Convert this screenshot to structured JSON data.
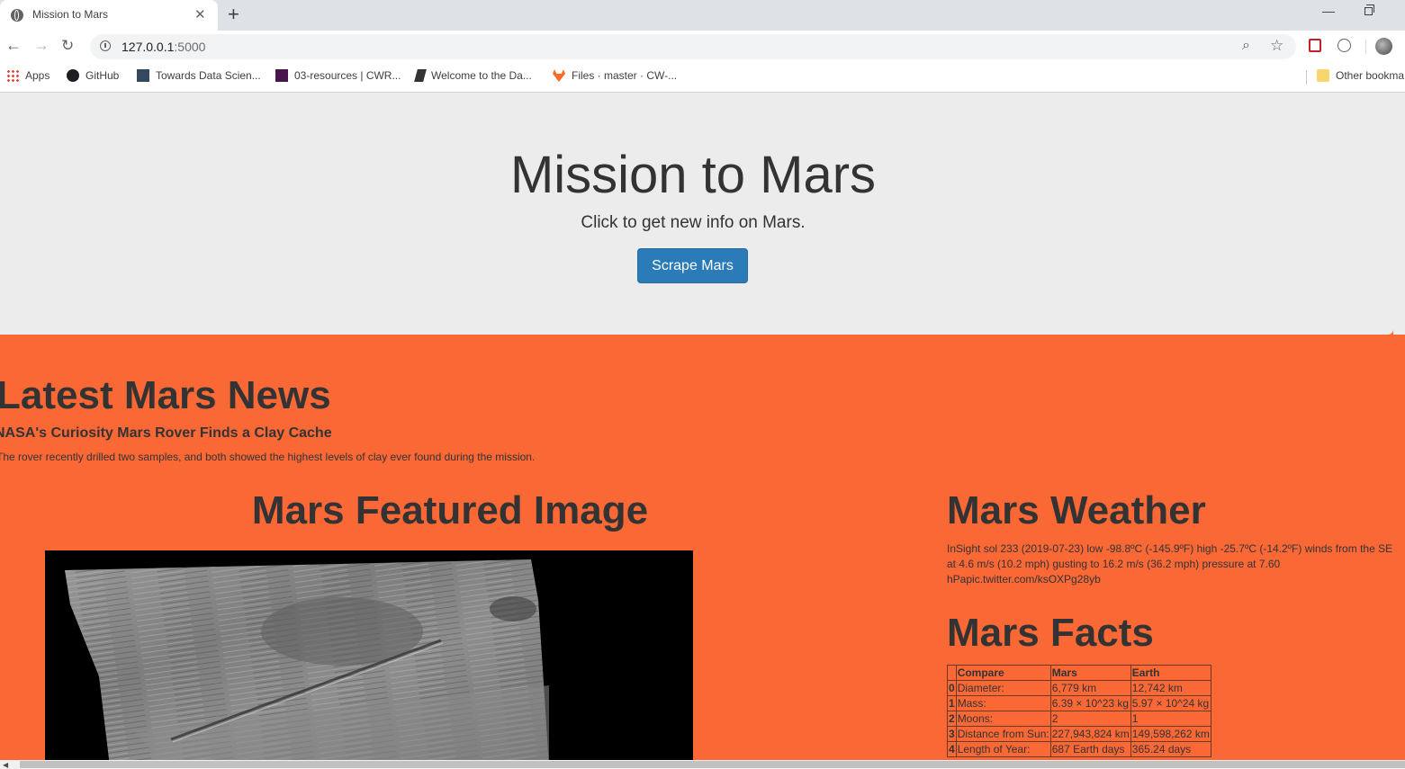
{
  "browser": {
    "tab_title": "Mission to Mars",
    "new_tab": "+",
    "url_host": "127.0.0.1",
    "url_port": ":5000",
    "bookmarks": {
      "apps": "Apps",
      "github": "GitHub",
      "tds": "Towards Data Scien...",
      "cwr": "03-resources | CWR...",
      "data": "Welcome to the Da...",
      "files": "Files · master · CW-...",
      "other": "Other bookma"
    },
    "icons": [
      "globe-icon",
      "close-icon",
      "plus-icon",
      "back-icon",
      "forward-icon",
      "reload-icon",
      "info-icon",
      "zoom-icon",
      "star-icon",
      "avatar"
    ]
  },
  "jumbotron": {
    "title": "Mission to Mars",
    "subtitle": "Click to get new info on Mars.",
    "button": "Scrape Mars"
  },
  "news": {
    "heading": "Latest Mars News",
    "title": "NASA's Curiosity Mars Rover Finds a Clay Cache",
    "teaser": "The rover recently drilled two samples, and both showed the highest levels of clay ever found during the mission."
  },
  "featured_image": {
    "heading": "Mars Featured Image"
  },
  "weather": {
    "heading": "Mars Weather",
    "text": "InSight sol 233 (2019-07-23) low -98.8ºC (-145.9ºF) high -25.7ºC (-14.2ºF) winds from the SE at 4.6 m/s (10.2 mph) gusting to 16.2 m/s (36.2 mph) pressure at 7.60 hPapic.twitter.com/ksOXPg28yb"
  },
  "facts": {
    "heading": "Mars Facts",
    "columns": [
      "",
      "Compare",
      "Mars",
      "Earth"
    ],
    "rows": [
      [
        "0",
        "Diameter:",
        "6,779 km",
        "12,742 km"
      ],
      [
        "1",
        "Mass:",
        "6.39 × 10^23 kg",
        "5.97 × 10^24 kg"
      ],
      [
        "2",
        "Moons:",
        "2",
        "1"
      ],
      [
        "3",
        "Distance from Sun:",
        "227,943,824 km",
        "149,598,262 km"
      ],
      [
        "4",
        "Length of Year:",
        "687 Earth days",
        "365.24 days"
      ]
    ]
  },
  "colors": {
    "page_bg": "#fa6836",
    "jumbotron_bg": "#ececec",
    "button_bg": "#2c7bb9",
    "text": "#333333"
  }
}
